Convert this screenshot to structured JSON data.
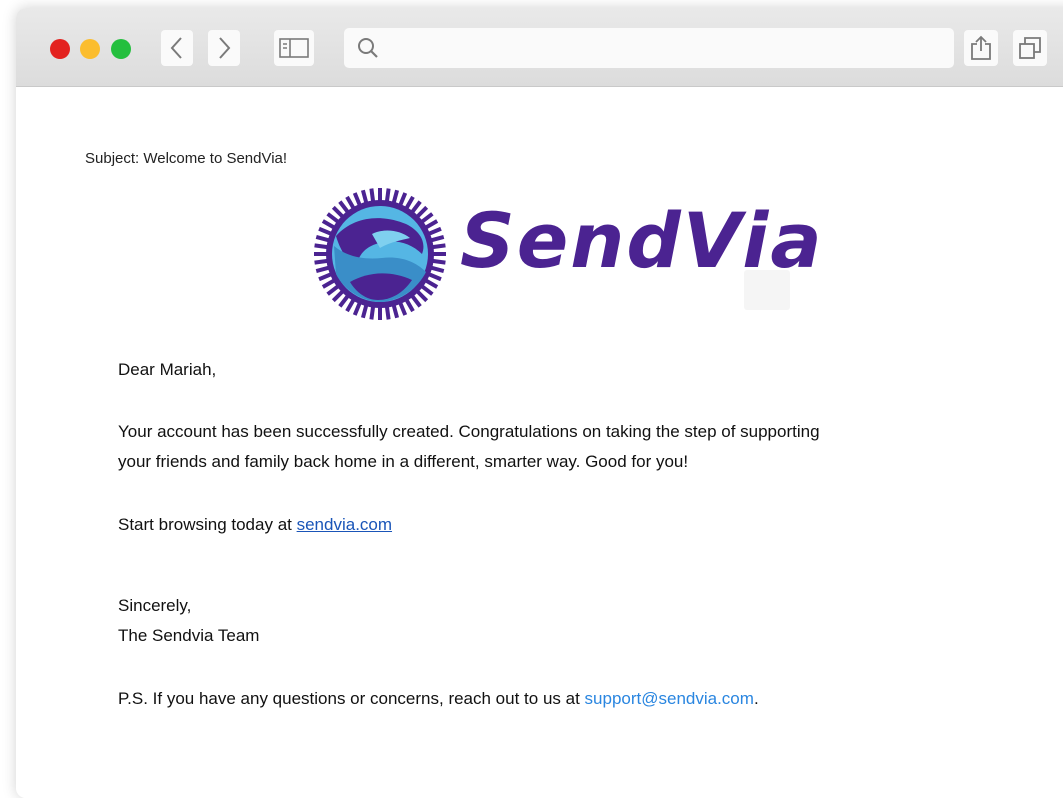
{
  "browser": {
    "window_controls": [
      "close",
      "minimize",
      "zoom"
    ],
    "address_bar": {
      "value": "",
      "placeholder": ""
    },
    "icons": {
      "back": "chevron-left-icon",
      "forward": "chevron-right-icon",
      "sidebar": "sidebar-icon",
      "search": "search-icon",
      "share": "share-icon",
      "tabs": "tabs-icon"
    },
    "colors": {
      "close": "#e3221f",
      "minimize": "#fbbd2e",
      "zoom": "#24bf3e"
    }
  },
  "email": {
    "subject": "Subject: Welcome to SendVia!",
    "logo_text": "SendVia",
    "greeting": "Dear Mariah,",
    "paragraph1_line1": "Your account has been successfully created. Congratulations on taking the step of supporting",
    "paragraph1_line2": "your friends and family back home in a different, smarter way. Good for you!",
    "browse_prefix": "Start browsing today at ",
    "browse_link": "sendvia.com",
    "signoff": "Sincerely,",
    "signature": "The Sendvia Team",
    "ps_prefix": "P.S. If you have any questions or concerns, reach out to us at ",
    "ps_email": "support@sendvia.com",
    "ps_suffix": ".",
    "brand_color": "#4b2391",
    "link_color": "#1a55b8"
  }
}
